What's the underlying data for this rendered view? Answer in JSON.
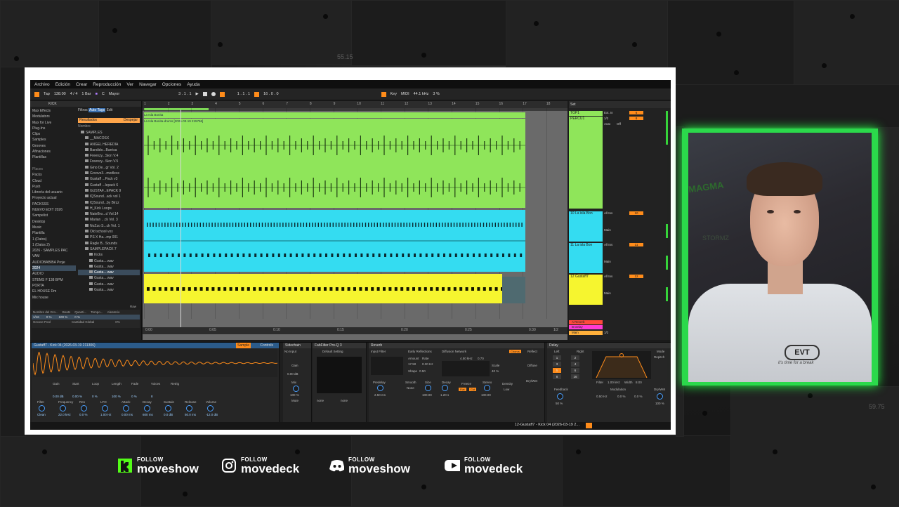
{
  "menu": [
    "Archivo",
    "Edición",
    "Crear",
    "Reproducción",
    "Ver",
    "Navegar",
    "Opciones",
    "Ayuda"
  ],
  "transport": {
    "tap": "Tap",
    "tempo": "138.00",
    "signature": "4 / 4",
    "quantize": "1 Bar",
    "key": "C",
    "scale": "Mayor",
    "position": "3 . 1 . 1",
    "loop_start": "1 . 1 . 1",
    "loop_len": "16 . 0 . 0",
    "key_label": "Key",
    "midi_label": "MIDI",
    "sample_rate": "44.1 kHz",
    "cpu": "3 %"
  },
  "browser": {
    "search": "KICK",
    "filters_label": "Filtros",
    "auto_tags": "Auto Tags",
    "edit": "Edit",
    "results_label": "Resultados",
    "clear_label": "Despejar",
    "name_header": "Nombre",
    "categories": [
      "Max Effects",
      "Modulators",
      "Max for Live",
      "Plug-Ins",
      "Clips",
      "Samples",
      "Grooves",
      "Afinaciones",
      "Plantillas",
      "",
      "Places",
      "Packs",
      "Cloud",
      "Push",
      "Librería del usuario",
      "Proyecto actual",
      "PACKSSS",
      "NUEVO EDIT 2026",
      "Sampelist",
      "Desktop",
      "Music",
      "Plantilla",
      "1 (Datos)",
      "1 (Datos 2)",
      "2026 - SAMPLES PAC",
      "VAM",
      "AUDIOBABIBA Proje",
      "2024",
      "AUDIO",
      "STEMS F 138 BPM",
      "PORTA",
      "EL HOUSE Dm",
      "Mix house"
    ],
    "files": [
      "SAMPLES",
      "__MACOSX",
      "ANGEL HEREDIA",
      "Bandido...Barrisa",
      "Freenzy...Sion V.4",
      "Freenzy...Sion V.5",
      "Gino De...gr Vol. 2",
      "Groove3...medless",
      "Gustaff ...Pack v3",
      "Gustaff ...lepack 6",
      "GUSTAF...EPACK 9",
      "IQSound...ack vol 1",
      "IQSound...by Birzz",
      "H_Kick Loops",
      "NateBro...d Vol.14",
      "Marian ...ck Vol. 3",
      "NoZzo S...ck Vol. 1",
      "Old school vox",
      "PS X Ha...mp 001",
      "Ragle B...Sounds",
      "SAMPLEPACK 7",
      "Kicks",
      "Gusta....wav",
      "Gusta....wav",
      "Gusta....wav",
      "Gusta....wav",
      "Gusta....wav",
      "Gusta....wav"
    ],
    "group_label": "Nombre del Gro...",
    "beats_label": "Beats",
    "quant_label": "Quanti...",
    "tempo_label": "Tempo...",
    "random_label": "Aleatorio",
    "groove_pool": "Groove Pool",
    "amount_label": "Cantidad Global",
    "amount_value": "0%",
    "swing_val": "1/16",
    "pct1": "0 %",
    "pct2": "100 %",
    "pct3": "0 %",
    "raw_label": "Raw"
  },
  "arrangement": {
    "bars": [
      "1",
      "2",
      "3",
      "4",
      "5",
      "6",
      "7",
      "8",
      "9",
      "10",
      "11",
      "12",
      "13",
      "14",
      "15",
      "16",
      "17",
      "18"
    ],
    "clip_top": "La Isla Bonita",
    "clip_sub": "La Isla Bonita-drums [2026-03-19 215756]",
    "times": [
      "0:00",
      "0:05",
      "0:10",
      "0:15",
      "0:20",
      "0:25",
      "0:30"
    ],
    "zoom": "1/2"
  },
  "mixer": {
    "set_label": "Set",
    "tracks": [
      {
        "name": "TOP1",
        "input": "Ext. In",
        "num": "6"
      },
      {
        "name": "PERCU1",
        "input": "1/2",
        "num": "8"
      },
      {
        "name": "10 La isla Bon",
        "input": "All Ins",
        "num": "10"
      },
      {
        "name": "11 La isla Bon",
        "input": "All Ins",
        "num": "11"
      },
      {
        "name": "12 Gustaff7",
        "input": "All Ins",
        "num": "12"
      }
    ],
    "auto_label": "Auto",
    "off_label": "Off",
    "main_label": "Main",
    "returns": [
      "A Reverb",
      "B Delay",
      "Main"
    ],
    "main_ratio": "1/2"
  },
  "devices": {
    "sampler_title": "Gustaff7 - Kick 04 (2026-03-19 211306)",
    "sample_tab": "Sample",
    "controls_tab": "Controls",
    "sampler_labels": [
      "Gain",
      "Start",
      "Loop",
      "Length",
      "Fade",
      "Voices",
      "Retrig",
      "Filter",
      "Frequency",
      "Res",
      "LFO",
      "Attack",
      "Decay",
      "Sustain",
      "Release",
      "Volume"
    ],
    "sampler_values": [
      "0.00 dB",
      "0.00 %",
      "0 %",
      "100 %",
      "0 %",
      "8",
      "",
      "Clean",
      "22.0 kHz",
      "0.0 %",
      "1.00 Hz",
      "0.00 ms",
      "600 ms",
      "0.0 dB",
      "50.0 ms",
      "-12.0 dB"
    ],
    "sidechain_title": "Sidechain",
    "no_input": "No Input",
    "gain_label": "Gain",
    "gain_value": "0.00 dB",
    "mix_label": "Mix",
    "mix_value": "100 %",
    "mute_label": "Mute",
    "fabfilter": "FabFilter Pro-Q 3",
    "default_setting": "Default Setting",
    "none1": "none",
    "none2": "none",
    "reverb_title": "Reverb",
    "input_filter": "Input Filter",
    "early_reflections": "Early Reflections",
    "diffusion": "Diffusion Network",
    "chorus": "Chorus",
    "reflect": "Reflect",
    "diffuse": "Diffuse",
    "dry_wet": "Dry/Wet",
    "predelay": "Predelay",
    "predelay_val": "2.50 ms",
    "smooth": "Smooth",
    "smooth_val": "None",
    "size": "Size",
    "size_val": "100.00",
    "decay": "Decay",
    "decay_val": "1.20 s",
    "freeze": "Freeze",
    "flat": "Flat",
    "cut": "Cut",
    "stereo": "Stereo",
    "stereo_val": "100.00",
    "density": "Density",
    "density_val": "Low",
    "amount_label": "Amount",
    "amount_val": "17.50",
    "rate_label": "Rate",
    "rate_val": "0.30 Hz",
    "shape_label": "Shape",
    "shape_val": "0.50",
    "hi_freq": "4.50 kHz",
    "hi_val": "0.70",
    "scale_label": "Scale",
    "scale_val": "40 %",
    "delay_title": "Delay",
    "left_label": "Left",
    "right_label": "Right",
    "feedback": "Feedback",
    "feedback_val": "50 %",
    "filter_label": "Filter",
    "filter_freq": "1.00 kHz",
    "width_label": "Width",
    "width_val": "8.00",
    "modulation": "Modulation",
    "mod_rate": "0.50 Hz",
    "mod_filter": "0.0 %",
    "mod_time": "0.0 %",
    "mode_label": "Mode",
    "mode_val": "Repitch",
    "delay_drywet": "Dry/Wet",
    "delay_drywet_val": "100 %",
    "sync_values": [
      "1",
      "2",
      "3",
      "4",
      "5",
      "6",
      "8",
      "16"
    ]
  },
  "status": {
    "clip_info": "12-Gustaff7 - Kick 04 (2026-03-19 2..."
  },
  "overlay": {
    "time_a": "55.15",
    "time_b": "59.75"
  },
  "webcam": {
    "shirt_logo": "EVT",
    "shirt_tag": "it's time for a break",
    "wall_text": "MAGMA",
    "wall_text2": "STORMZ"
  },
  "socials": [
    {
      "platform": "kick",
      "follow": "FOLLOW",
      "handle": "moveshow",
      "color": "#53fc18"
    },
    {
      "platform": "instagram",
      "follow": "FOLLOW",
      "handle": "movedeck",
      "color": "#ffffff"
    },
    {
      "platform": "discord",
      "follow": "FOLLOW",
      "handle": "moveshow",
      "color": "#ffffff"
    },
    {
      "platform": "youtube",
      "follow": "FOLLOW",
      "handle": "movedeck",
      "color": "#ffffff"
    }
  ],
  "colors": {
    "accent_orange": "#ff8c1a",
    "clip_green": "#8fe55a",
    "clip_cyan": "#34dcf1",
    "clip_yellow": "#f6f52f",
    "cam_glow": "#2bd94b"
  }
}
